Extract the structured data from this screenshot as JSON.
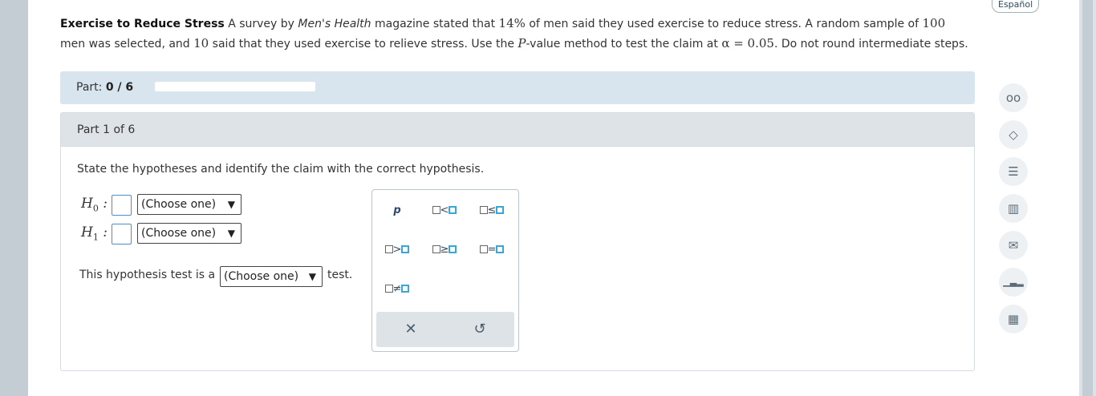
{
  "language_button": "Español",
  "problem": {
    "title": "Exercise to Reduce Stress",
    "text_1": " A survey by ",
    "magazine": "Men's Health",
    "text_2": " magazine stated that ",
    "pct": "14%",
    "text_3": " of men said they used exercise to reduce stress. A random sample of ",
    "n": "100",
    "text_4": "men was selected, and ",
    "x": "10",
    "text_5": " said that they used exercise to relieve stress. Use the ",
    "pvar": "P",
    "text_6": "-value method to test the claim at ",
    "alpha": "α = 0.05",
    "text_7": ". Do not round intermediate steps."
  },
  "progress": {
    "prefix": "Part: ",
    "value": "0 / 6",
    "fraction": 0
  },
  "part": {
    "header": "Part 1 of 6",
    "instructions": "State the hypotheses and identify the claim with the correct hypothesis.",
    "h0_label": "H",
    "h0_sub": "0",
    "h1_label": "H",
    "h1_sub": "1",
    "colon": ":",
    "h0_select": "(Choose one)",
    "h1_select": "(Choose one)",
    "test_prefix": "This hypothesis test is a",
    "test_select": "(Choose one)",
    "test_suffix": "test.",
    "select_arrow": "▼"
  },
  "palette": {
    "p": "p",
    "lt": "<",
    "le": "≤",
    "gt": ">",
    "ge": "≥",
    "eq": "=",
    "ne": "≠",
    "clear": "✕",
    "undo": "↺"
  },
  "side_tools": [
    {
      "name": "glasses-icon",
      "glyph": "oo"
    },
    {
      "name": "hint-icon",
      "glyph": "◇"
    },
    {
      "name": "notes-icon",
      "glyph": "☰"
    },
    {
      "name": "textbook-icon",
      "glyph": "▥"
    },
    {
      "name": "message-icon",
      "glyph": "✉"
    },
    {
      "name": "chart-icon",
      "glyph": "▁▃▂"
    },
    {
      "name": "calculator-icon",
      "glyph": "▦"
    }
  ],
  "colors": {
    "accent": "#4a90c6",
    "progress_bg": "#d9e5ee",
    "header_bg": "#dde3e7"
  }
}
